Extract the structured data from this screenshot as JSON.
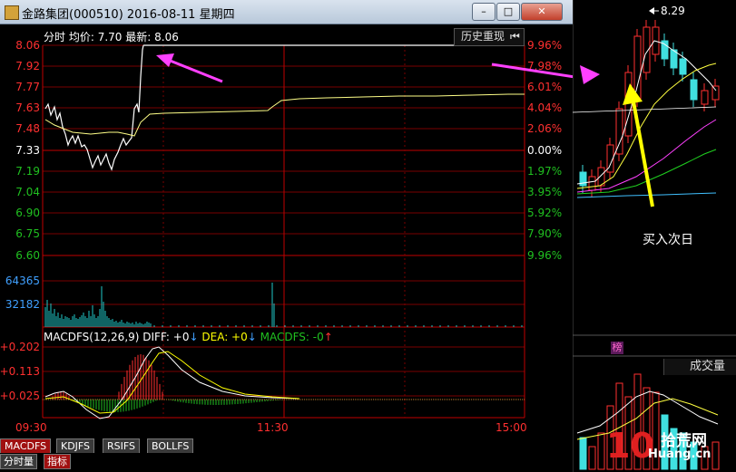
{
  "window": {
    "title": "金路集团(000510)  2016-08-11 星期四",
    "minimize_label": "–",
    "maximize_label": "□",
    "close_label": "✕"
  },
  "price_panel": {
    "info_label": "分时",
    "avg_label": "均价:",
    "avg_value": "7.70",
    "latest_label": "最新:",
    "latest_value": "8.06",
    "history_button": "历史重现",
    "history_icon": "skip-back-icon",
    "price_ticks": [
      "8.06",
      "7.92",
      "7.77",
      "7.63",
      "7.48",
      "7.33",
      "7.19",
      "7.04",
      "6.90",
      "6.75",
      "6.60"
    ],
    "pct_ticks": [
      "9.96%",
      "7.98%",
      "6.01%",
      "4.04%",
      "2.06%",
      "0.00%",
      "1.97%",
      "3.95%",
      "5.92%",
      "7.90%",
      "9.96%"
    ],
    "volume_ticks": [
      "64365",
      "32182"
    ],
    "time_ticks": [
      "09:30",
      "11:30",
      "15:00"
    ]
  },
  "macd_panel": {
    "title": "MACDFS(12,26,9)",
    "diff_label": "DIFF: +0",
    "dea_label": "DEA: +0",
    "macdfs_label": "MACDFS: -0",
    "ticks": [
      "+0.202",
      "+0.113",
      "+0.025"
    ]
  },
  "tabs": [
    "MACDFS",
    "KDJFS",
    "RSIFS",
    "BOLLFS"
  ],
  "bottom_tabs": [
    "分时量",
    "指标"
  ],
  "right_panel": {
    "high_price": "8.29",
    "annotation": "买入次日",
    "bang_label": "榜",
    "volume_label": "成交量",
    "logo_number": "10",
    "logo_cn": "拾荒网",
    "logo_en": "Huang.cn"
  },
  "colors": {
    "up": "#ff3030",
    "down": "#20c020",
    "grid": "#7a0000",
    "price_line": "#ffffff",
    "avg_line": "#ffff88",
    "arrow_magenta": "#ff40ff",
    "arrow_yellow": "#ffff00"
  }
}
